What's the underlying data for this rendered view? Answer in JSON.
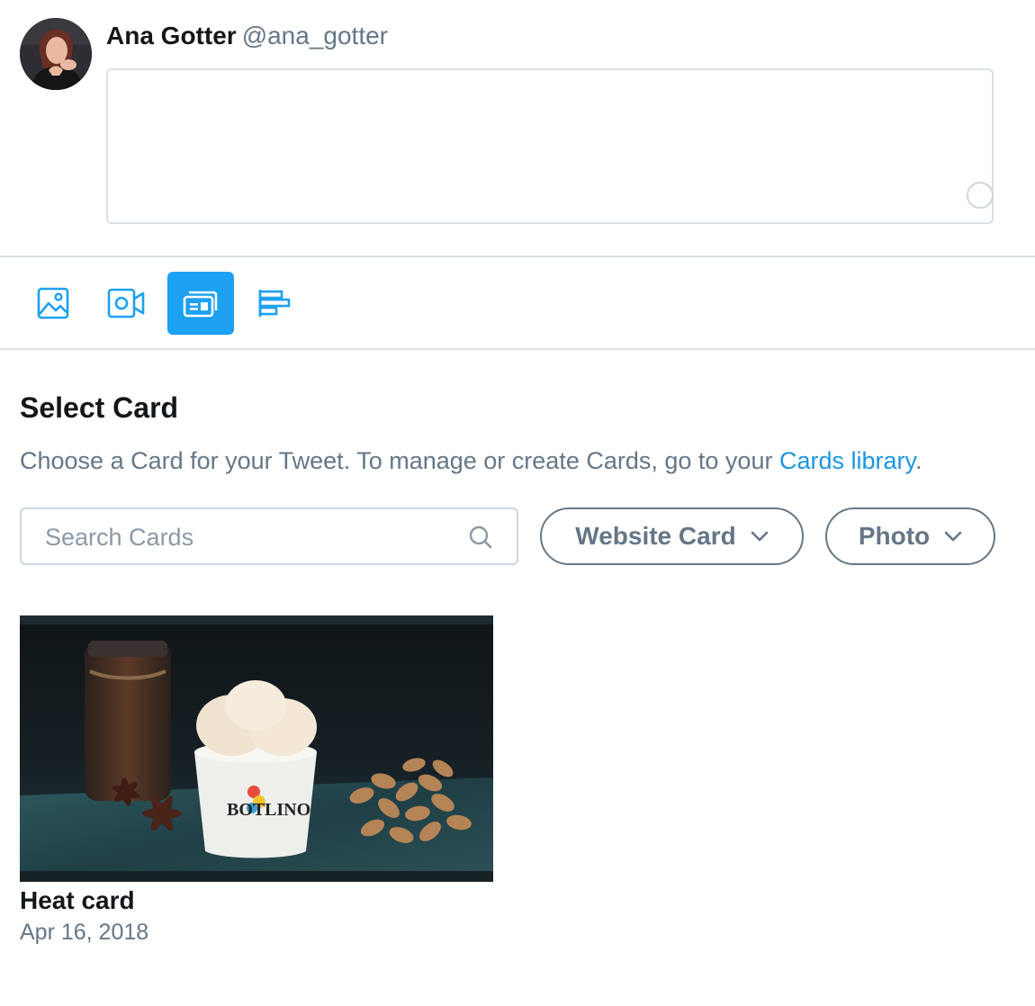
{
  "composer": {
    "display_name": "Ana Gotter",
    "handle": "@ana_gotter",
    "tweet_text": ""
  },
  "toolbar": {
    "items": [
      {
        "icon": "image-icon",
        "active": false
      },
      {
        "icon": "video-icon",
        "active": false
      },
      {
        "icon": "card-icon",
        "active": true
      },
      {
        "icon": "poll-icon",
        "active": false
      }
    ]
  },
  "select_card": {
    "title": "Select Card",
    "description": "Choose a Card for your Tweet. To manage or create Cards, go to your ",
    "link_text": "Cards library",
    "description_end": ".",
    "search": {
      "placeholder": "Search Cards",
      "value": ""
    },
    "type_filter": {
      "selected": "Website Card"
    },
    "media_filter": {
      "selected": "Photo"
    }
  },
  "cards": [
    {
      "title": "Heat card",
      "date": "Apr 16, 2018",
      "image_brand_text": "BOT LINO"
    }
  ],
  "colors": {
    "accent": "#1da1f2",
    "link": "#1b95e0",
    "secondary_text": "#657786",
    "border": "#ccd6dd"
  }
}
